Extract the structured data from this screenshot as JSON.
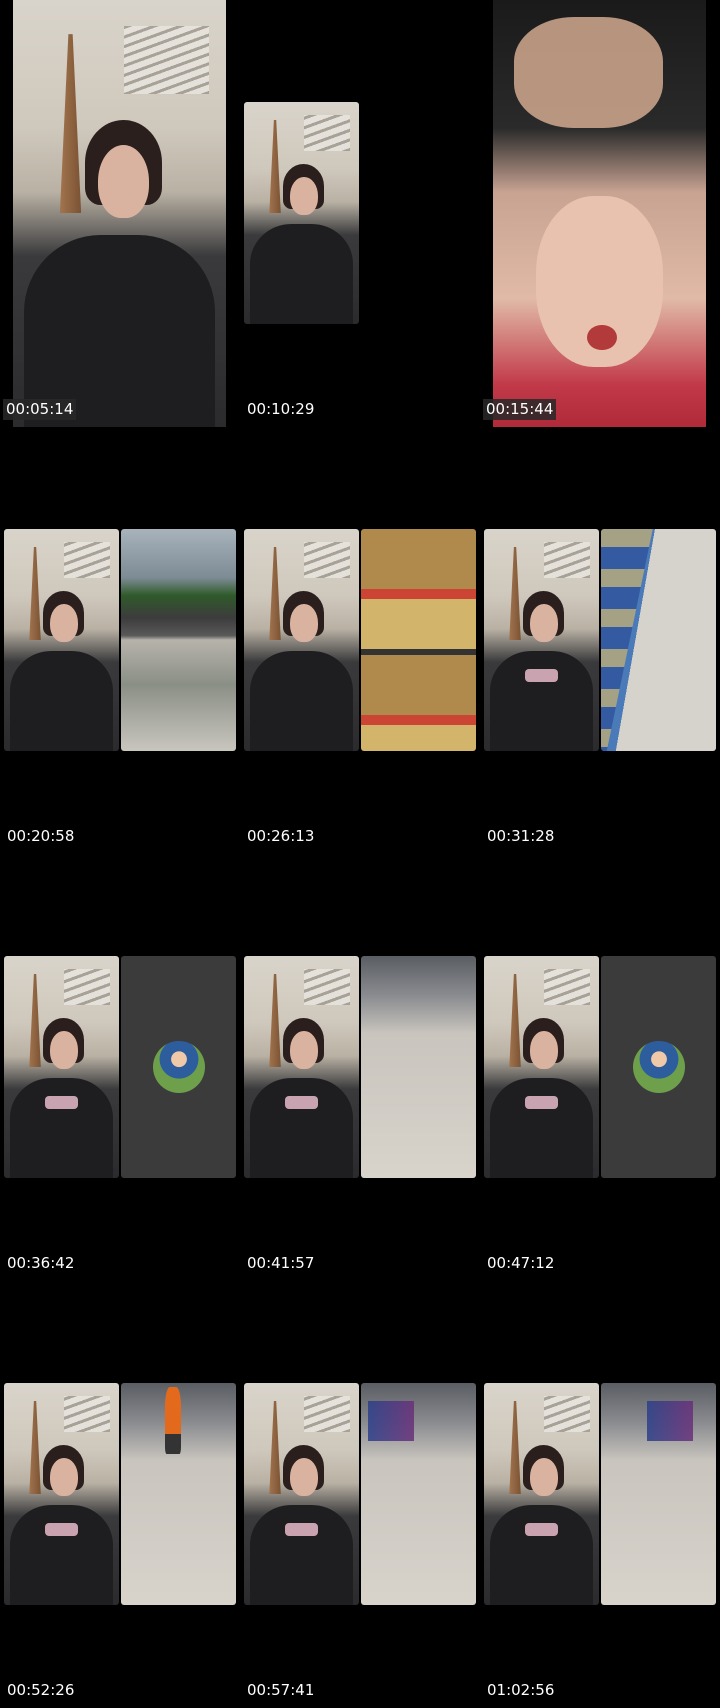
{
  "cells": [
    {
      "timestamp": "00:05:14",
      "panels": [
        "salon"
      ],
      "timestamp_boxed": true
    },
    {
      "timestamp": "00:10:29",
      "panels": [
        "salon"
      ],
      "timestamp_boxed": false
    },
    {
      "timestamp": "00:15:44",
      "panels": [
        "hairwash"
      ],
      "timestamp_boxed": true
    },
    {
      "timestamp": "00:20:58",
      "panels": [
        "salon",
        "road"
      ]
    },
    {
      "timestamp": "00:26:13",
      "panels": [
        "salon",
        "shelf"
      ]
    },
    {
      "timestamp": "00:31:28",
      "panels": [
        "salon",
        "shop"
      ]
    },
    {
      "timestamp": "00:36:42",
      "panels": [
        "salon",
        "call"
      ]
    },
    {
      "timestamp": "00:41:57",
      "panels": [
        "salon",
        "station"
      ]
    },
    {
      "timestamp": "00:47:12",
      "panels": [
        "salon",
        "call"
      ]
    },
    {
      "timestamp": "00:52:26",
      "panels": [
        "salon",
        "station-worker"
      ]
    },
    {
      "timestamp": "00:57:41",
      "panels": [
        "salon",
        "station"
      ]
    },
    {
      "timestamp": "01:02:56",
      "panels": [
        "salon",
        "station"
      ]
    }
  ]
}
